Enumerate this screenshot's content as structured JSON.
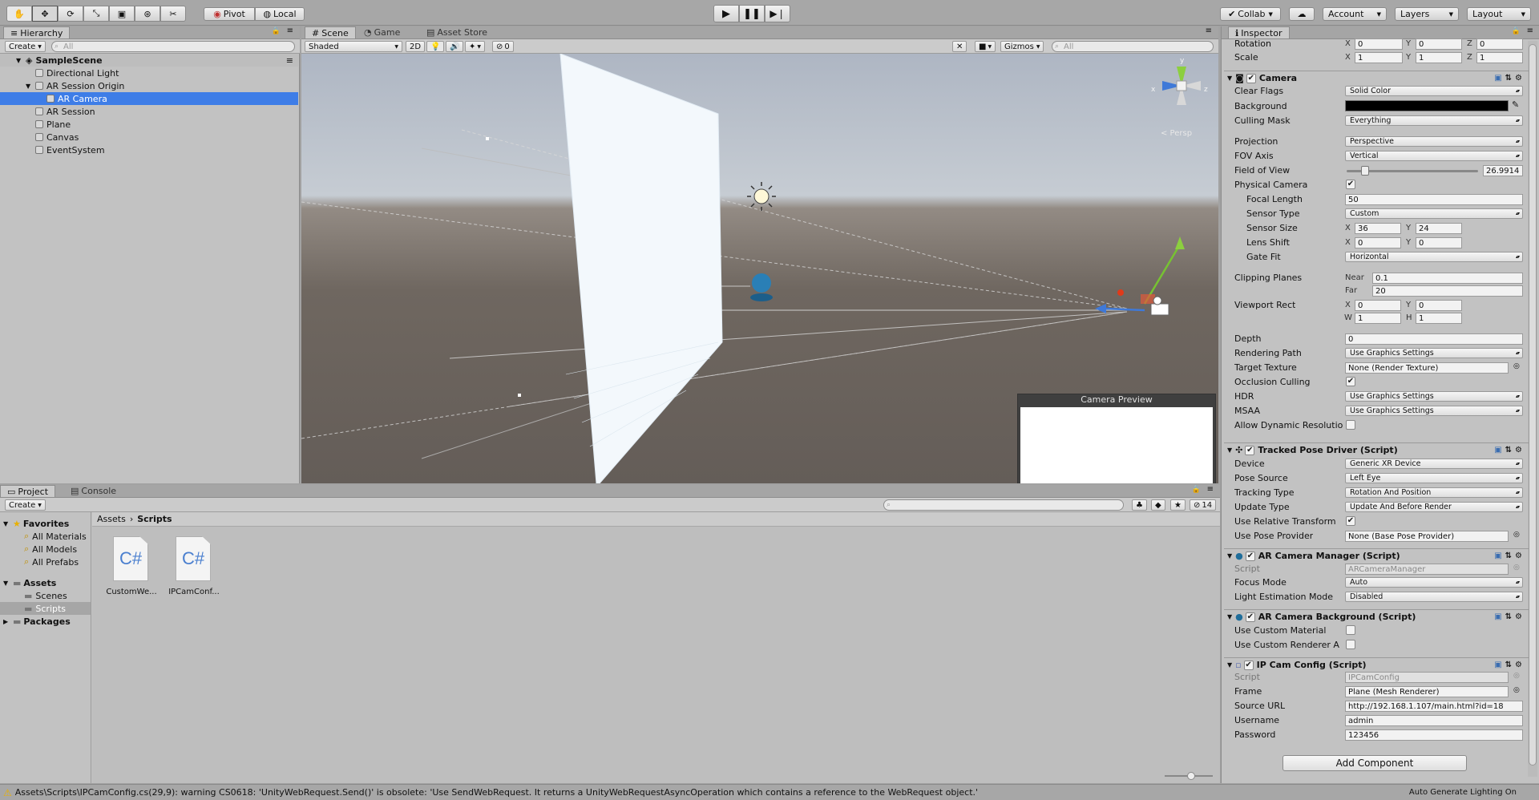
{
  "toolbar": {
    "tools": [
      "hand-icon",
      "move-icon",
      "rotate-icon",
      "scale-icon",
      "rect-icon",
      "transform-icon",
      "custom-tool-icon"
    ],
    "pivot": "Pivot",
    "local": "Local",
    "collab": "Collab",
    "account": "Account",
    "layers": "Layers",
    "layout": "Layout"
  },
  "hierarchy": {
    "tab": "Hierarchy",
    "create": "Create",
    "search": "All",
    "scene": "SampleScene",
    "items": [
      {
        "label": "Directional Light",
        "indent": 0
      },
      {
        "label": "AR Session Origin",
        "indent": 0
      },
      {
        "label": "AR Camera",
        "indent": 1,
        "selected": true
      },
      {
        "label": "AR Session",
        "indent": 0
      },
      {
        "label": "Plane",
        "indent": 0
      },
      {
        "label": "Canvas",
        "indent": 0
      },
      {
        "label": "EventSystem",
        "indent": 0
      }
    ]
  },
  "scene": {
    "tabs": [
      "Scene",
      "Game",
      "Asset Store"
    ],
    "shading": "Shaded",
    "mode2d": "2D",
    "hidden_count": "0",
    "gizmos": "Gizmos",
    "search": "All",
    "persp": "< Persp",
    "axis_x": "x",
    "axis_y": "y",
    "axis_z": "z",
    "preview_title": "Camera Preview"
  },
  "project": {
    "tabs": [
      "Project",
      "Console"
    ],
    "create": "Create",
    "count": "14",
    "favorites_title": "Favorites",
    "favorites": [
      "All Materials",
      "All Models",
      "All Prefabs"
    ],
    "assets_title": "Assets",
    "assets": [
      "Scenes",
      "Scripts"
    ],
    "packages": "Packages",
    "breadcrumb": [
      "Assets",
      "Scripts"
    ],
    "files": [
      {
        "icon": "C#",
        "name": "CustomWe..."
      },
      {
        "icon": "C#",
        "name": "IPCamConf..."
      }
    ]
  },
  "status": {
    "warning": "Assets\\Scripts\\IPCamConfig.cs(29,9): warning CS0618: 'UnityWebRequest.Send()' is obsolete: 'Use SendWebRequest.  It returns a UnityWebRequestAsyncOperation which contains a reference to the WebRequest object.'",
    "lighting": "Auto Generate Lighting On"
  },
  "inspector": {
    "tab": "Inspector",
    "transform": {
      "rotation_label": "Rotation",
      "rotation": [
        "0",
        "0",
        "0"
      ],
      "scale_label": "Scale",
      "scale": [
        "1",
        "1",
        "1"
      ]
    },
    "camera": {
      "title": "Camera",
      "clear_flags_l": "Clear Flags",
      "clear_flags": "Solid Color",
      "background_l": "Background",
      "culling_l": "Culling Mask",
      "culling": "Everything",
      "projection_l": "Projection",
      "projection": "Perspective",
      "fov_axis_l": "FOV Axis",
      "fov_axis": "Vertical",
      "fov_l": "Field of View",
      "fov": "26.9914",
      "fov_fraction": 0.12,
      "physical_l": "Physical Camera",
      "focal_l": "Focal Length",
      "focal": "50",
      "sensor_type_l": "Sensor Type",
      "sensor_type": "Custom",
      "sensor_size_l": "Sensor Size",
      "sensor_x": "36",
      "sensor_y": "24",
      "lens_l": "Lens Shift",
      "lens_x": "0",
      "lens_y": "0",
      "gate_l": "Gate Fit",
      "gate": "Horizontal",
      "clip_l": "Clipping Planes",
      "near_l": "Near",
      "near": "0.1",
      "far_l": "Far",
      "far": "20",
      "viewport_l": "Viewport Rect",
      "vx": "0",
      "vy": "0",
      "vw": "1",
      "vh": "1",
      "depth_l": "Depth",
      "depth": "0",
      "render_path_l": "Rendering Path",
      "render_path": "Use Graphics Settings",
      "target_l": "Target Texture",
      "target": "None (Render Texture)",
      "occlusion_l": "Occlusion Culling",
      "hdr_l": "HDR",
      "hdr": "Use Graphics Settings",
      "msaa_l": "MSAA",
      "msaa": "Use Graphics Settings",
      "dyn_l": "Allow Dynamic Resolutio"
    },
    "tracked": {
      "title": "Tracked Pose Driver (Script)",
      "device_l": "Device",
      "device": "Generic XR Device",
      "pose_l": "Pose Source",
      "pose": "Left Eye",
      "tracking_l": "Tracking Type",
      "tracking": "Rotation And Position",
      "update_l": "Update Type",
      "update": "Update And Before Render",
      "relative_l": "Use Relative Transform",
      "provider_l": "Use Pose Provider",
      "provider": "None (Base Pose Provider)"
    },
    "arcm": {
      "title": "AR Camera Manager (Script)",
      "script_l": "Script",
      "script": "ARCameraManager",
      "focus_l": "Focus Mode",
      "focus": "Auto",
      "light_l": "Light Estimation Mode",
      "light": "Disabled"
    },
    "arcb": {
      "title": "AR Camera Background (Script)",
      "mat_l": "Use Custom Material",
      "rend_l": "Use Custom Renderer A"
    },
    "ipcam": {
      "title": "IP Cam Config (Script)",
      "script_l": "Script",
      "script": "IPCamConfig",
      "frame_l": "Frame",
      "frame": "Plane (Mesh Renderer)",
      "url_l": "Source URL",
      "url": "http://192.168.1.107/main.html?id=18",
      "user_l": "Username",
      "user": "admin",
      "pass_l": "Password",
      "pass": "123456"
    },
    "add_component": "Add Component"
  },
  "colors": {
    "selection": "#3e7de7",
    "panel": "#c2c2c2",
    "sky": "#b4bcc8",
    "ground": "#6c635c"
  }
}
